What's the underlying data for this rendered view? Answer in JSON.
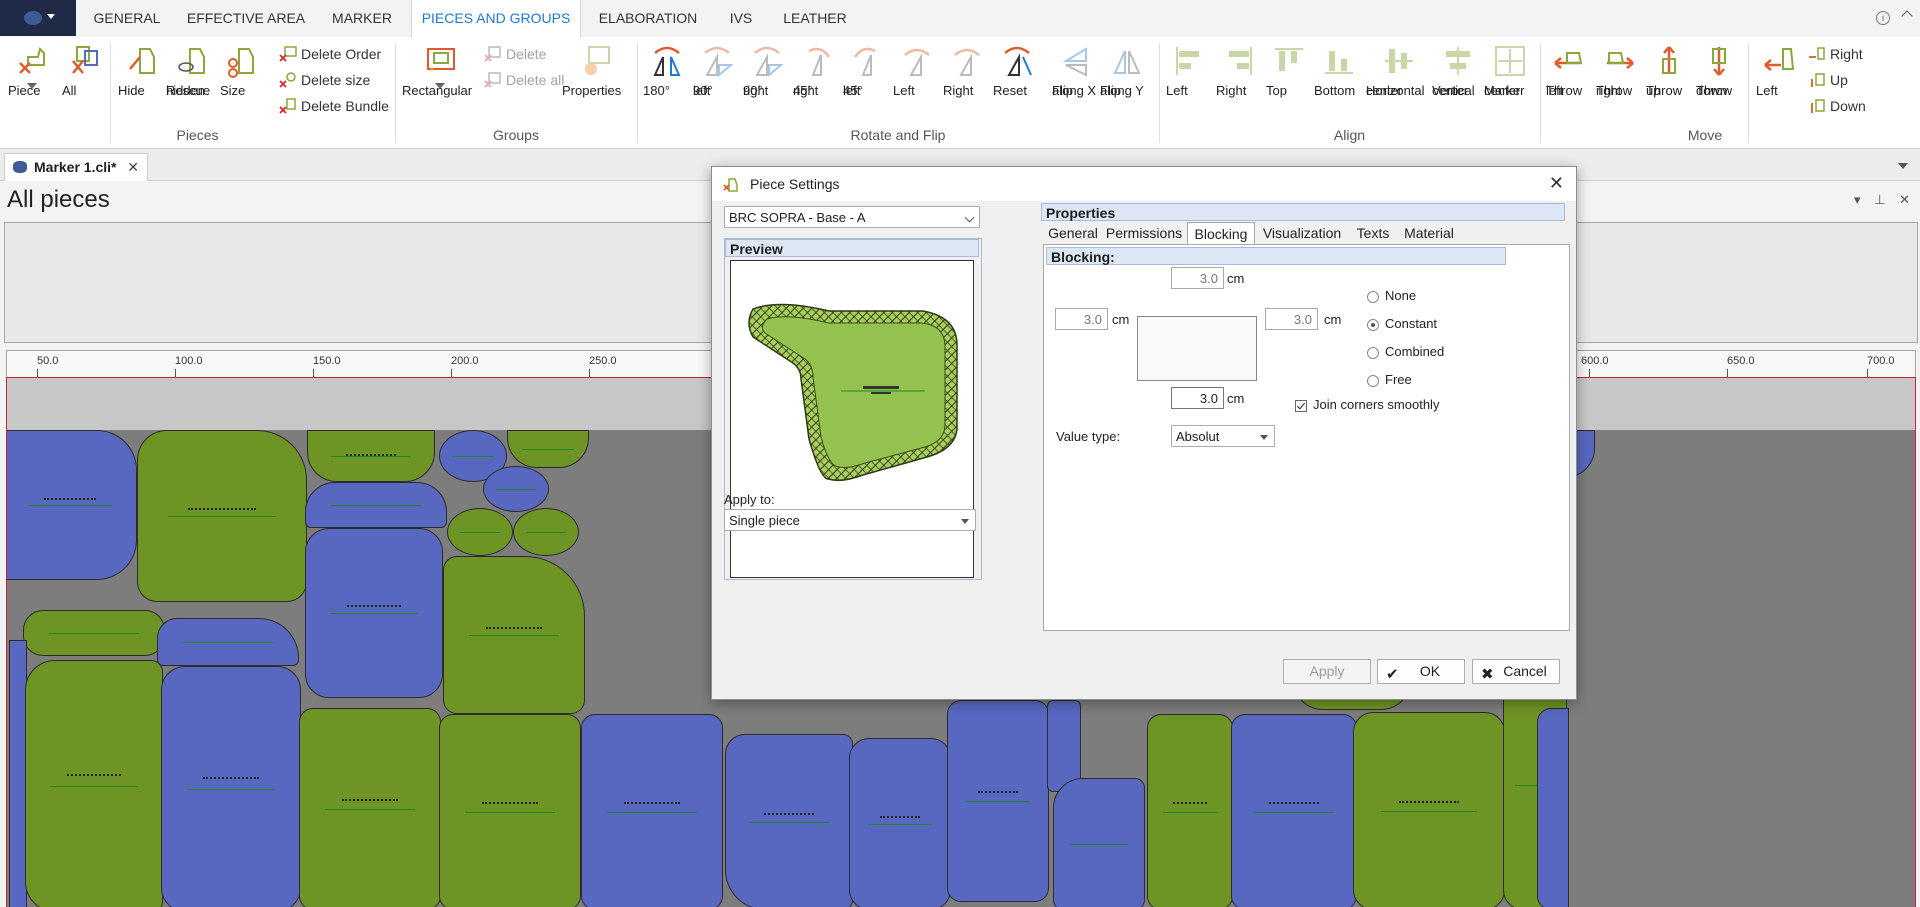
{
  "menu": {
    "tabs": [
      "GENERAL",
      "EFFECTIVE AREA",
      "MARKER",
      "PIECES AND GROUPS",
      "ELABORATION",
      "IVS",
      "LEATHER"
    ],
    "active_tab": "PIECES AND GROUPS"
  },
  "ribbon": {
    "pieces": {
      "group_label": "Pieces",
      "piece": "Piece",
      "all": "All",
      "hide": "Hide",
      "rescue_hidden": [
        "Rescue",
        "hidden"
      ],
      "size": "Size",
      "delete_order": "Delete Order",
      "delete_size": "Delete size",
      "delete_bundle": "Delete Bundle"
    },
    "groups": {
      "group_label": "Groups",
      "rectangular": "Rectangular",
      "delete": "Delete",
      "delete_all": "Delete all",
      "properties": "Properties"
    },
    "rotate_flip": {
      "group_label": "Rotate and Flip",
      "r180": [
        "180°",
        ""
      ],
      "r90_left": [
        "90°",
        "left"
      ],
      "r90_right": [
        "90°",
        "right"
      ],
      "r45_right": [
        "45°",
        "right"
      ],
      "r45_left": [
        "45°",
        "left"
      ],
      "left": [
        "Left",
        ""
      ],
      "right": [
        "Right",
        ""
      ],
      "reset": [
        "Reset",
        ""
      ],
      "flip_x": [
        "Flip",
        "along X"
      ],
      "flip_y": [
        "Flip",
        "along Y"
      ]
    },
    "align": {
      "group_label": "Align",
      "left": [
        "Left",
        ""
      ],
      "right": [
        "Right",
        ""
      ],
      "top": [
        "Top",
        ""
      ],
      "bottom": [
        "Bottom",
        ""
      ],
      "horizontal_center": [
        "Horizontal",
        "center"
      ],
      "vertical_center": [
        "Vertical",
        "center"
      ],
      "marker_center": [
        "Marker",
        "center"
      ]
    },
    "move": {
      "group_label": "Move",
      "throw_left": [
        "Throw",
        "left"
      ],
      "throw_right": [
        "Throw",
        "right"
      ],
      "throw_up": [
        "Throw",
        "up"
      ],
      "throw_down": [
        "Throw",
        "down"
      ],
      "left": "Left",
      "right": "Right",
      "up": "Up",
      "down": "Down"
    }
  },
  "document": {
    "tab": "Marker 1.cli*",
    "close": "✕"
  },
  "panel": {
    "title": "All pieces",
    "ruler_labels": [
      "50.0",
      "100.0",
      "150.0",
      "200.0",
      "250.0",
      "600.0",
      "650.0",
      "700.0"
    ]
  },
  "dialog": {
    "title": "Piece Settings",
    "piece_select": "BRC SOPRA - Base - A",
    "preview_header": "Preview",
    "apply_to_label": "Apply to:",
    "apply_to_value": "Single piece",
    "properties_header": "Properties",
    "tabs": [
      "General",
      "Permissions",
      "Blocking",
      "Visualization",
      "Texts",
      "Material"
    ],
    "active_tab": "Blocking",
    "blocking_header": "Blocking:",
    "top_value": "3.0",
    "left_value": "3.0",
    "right_value": "3.0",
    "bottom_value": "3.0",
    "unit": "cm",
    "modes": [
      "None",
      "Constant",
      "Combined",
      "Free"
    ],
    "selected_mode": "Constant",
    "join_corners_label": "Join corners smoothly",
    "join_corners": true,
    "value_type_label": "Value type:",
    "value_type": "Absolut",
    "buttons": {
      "apply": "Apply",
      "ok": "OK",
      "cancel": "Cancel"
    }
  },
  "colors": {
    "accent": "#1f7ad0",
    "piece_blue": "#5868c0",
    "piece_green": "#6f9426",
    "canvas_bg": "#7d7d7d"
  }
}
